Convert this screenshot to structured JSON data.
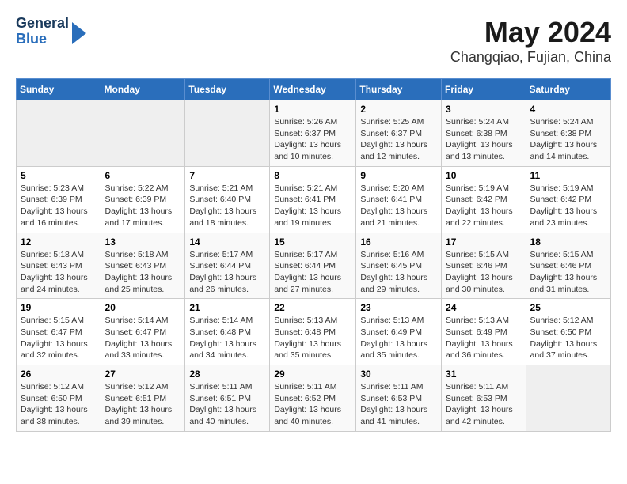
{
  "header": {
    "logo_general": "General",
    "logo_blue": "Blue",
    "title": "May 2024",
    "subtitle": "Changqiao, Fujian, China"
  },
  "weekdays": [
    "Sunday",
    "Monday",
    "Tuesday",
    "Wednesday",
    "Thursday",
    "Friday",
    "Saturday"
  ],
  "weeks": [
    [
      {
        "day": "",
        "info": ""
      },
      {
        "day": "",
        "info": ""
      },
      {
        "day": "",
        "info": ""
      },
      {
        "day": "1",
        "info": "Sunrise: 5:26 AM\nSunset: 6:37 PM\nDaylight: 13 hours\nand 10 minutes."
      },
      {
        "day": "2",
        "info": "Sunrise: 5:25 AM\nSunset: 6:37 PM\nDaylight: 13 hours\nand 12 minutes."
      },
      {
        "day": "3",
        "info": "Sunrise: 5:24 AM\nSunset: 6:38 PM\nDaylight: 13 hours\nand 13 minutes."
      },
      {
        "day": "4",
        "info": "Sunrise: 5:24 AM\nSunset: 6:38 PM\nDaylight: 13 hours\nand 14 minutes."
      }
    ],
    [
      {
        "day": "5",
        "info": "Sunrise: 5:23 AM\nSunset: 6:39 PM\nDaylight: 13 hours\nand 16 minutes."
      },
      {
        "day": "6",
        "info": "Sunrise: 5:22 AM\nSunset: 6:39 PM\nDaylight: 13 hours\nand 17 minutes."
      },
      {
        "day": "7",
        "info": "Sunrise: 5:21 AM\nSunset: 6:40 PM\nDaylight: 13 hours\nand 18 minutes."
      },
      {
        "day": "8",
        "info": "Sunrise: 5:21 AM\nSunset: 6:41 PM\nDaylight: 13 hours\nand 19 minutes."
      },
      {
        "day": "9",
        "info": "Sunrise: 5:20 AM\nSunset: 6:41 PM\nDaylight: 13 hours\nand 21 minutes."
      },
      {
        "day": "10",
        "info": "Sunrise: 5:19 AM\nSunset: 6:42 PM\nDaylight: 13 hours\nand 22 minutes."
      },
      {
        "day": "11",
        "info": "Sunrise: 5:19 AM\nSunset: 6:42 PM\nDaylight: 13 hours\nand 23 minutes."
      }
    ],
    [
      {
        "day": "12",
        "info": "Sunrise: 5:18 AM\nSunset: 6:43 PM\nDaylight: 13 hours\nand 24 minutes."
      },
      {
        "day": "13",
        "info": "Sunrise: 5:18 AM\nSunset: 6:43 PM\nDaylight: 13 hours\nand 25 minutes."
      },
      {
        "day": "14",
        "info": "Sunrise: 5:17 AM\nSunset: 6:44 PM\nDaylight: 13 hours\nand 26 minutes."
      },
      {
        "day": "15",
        "info": "Sunrise: 5:17 AM\nSunset: 6:44 PM\nDaylight: 13 hours\nand 27 minutes."
      },
      {
        "day": "16",
        "info": "Sunrise: 5:16 AM\nSunset: 6:45 PM\nDaylight: 13 hours\nand 29 minutes."
      },
      {
        "day": "17",
        "info": "Sunrise: 5:15 AM\nSunset: 6:46 PM\nDaylight: 13 hours\nand 30 minutes."
      },
      {
        "day": "18",
        "info": "Sunrise: 5:15 AM\nSunset: 6:46 PM\nDaylight: 13 hours\nand 31 minutes."
      }
    ],
    [
      {
        "day": "19",
        "info": "Sunrise: 5:15 AM\nSunset: 6:47 PM\nDaylight: 13 hours\nand 32 minutes."
      },
      {
        "day": "20",
        "info": "Sunrise: 5:14 AM\nSunset: 6:47 PM\nDaylight: 13 hours\nand 33 minutes."
      },
      {
        "day": "21",
        "info": "Sunrise: 5:14 AM\nSunset: 6:48 PM\nDaylight: 13 hours\nand 34 minutes."
      },
      {
        "day": "22",
        "info": "Sunrise: 5:13 AM\nSunset: 6:48 PM\nDaylight: 13 hours\nand 35 minutes."
      },
      {
        "day": "23",
        "info": "Sunrise: 5:13 AM\nSunset: 6:49 PM\nDaylight: 13 hours\nand 35 minutes."
      },
      {
        "day": "24",
        "info": "Sunrise: 5:13 AM\nSunset: 6:49 PM\nDaylight: 13 hours\nand 36 minutes."
      },
      {
        "day": "25",
        "info": "Sunrise: 5:12 AM\nSunset: 6:50 PM\nDaylight: 13 hours\nand 37 minutes."
      }
    ],
    [
      {
        "day": "26",
        "info": "Sunrise: 5:12 AM\nSunset: 6:50 PM\nDaylight: 13 hours\nand 38 minutes."
      },
      {
        "day": "27",
        "info": "Sunrise: 5:12 AM\nSunset: 6:51 PM\nDaylight: 13 hours\nand 39 minutes."
      },
      {
        "day": "28",
        "info": "Sunrise: 5:11 AM\nSunset: 6:51 PM\nDaylight: 13 hours\nand 40 minutes."
      },
      {
        "day": "29",
        "info": "Sunrise: 5:11 AM\nSunset: 6:52 PM\nDaylight: 13 hours\nand 40 minutes."
      },
      {
        "day": "30",
        "info": "Sunrise: 5:11 AM\nSunset: 6:53 PM\nDaylight: 13 hours\nand 41 minutes."
      },
      {
        "day": "31",
        "info": "Sunrise: 5:11 AM\nSunset: 6:53 PM\nDaylight: 13 hours\nand 42 minutes."
      },
      {
        "day": "",
        "info": ""
      }
    ]
  ]
}
